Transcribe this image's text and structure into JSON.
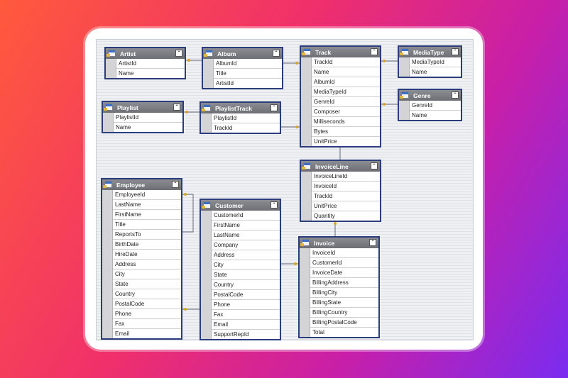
{
  "tables": {
    "artist": {
      "title": "Artist",
      "fields": [
        "ArtistId",
        "Name"
      ]
    },
    "album": {
      "title": "Album",
      "fields": [
        "AlbumId",
        "Title",
        "ArtistId"
      ]
    },
    "track": {
      "title": "Track",
      "fields": [
        "TrackId",
        "Name",
        "AlbumId",
        "MediaTypeId",
        "GenreId",
        "Composer",
        "Milliseconds",
        "Bytes",
        "UnitPrice"
      ]
    },
    "mediatype": {
      "title": "MediaType",
      "fields": [
        "MediaTypeId",
        "Name"
      ]
    },
    "genre": {
      "title": "Genre",
      "fields": [
        "GenreId",
        "Name"
      ]
    },
    "playlist": {
      "title": "Playlist",
      "fields": [
        "PlaylistId",
        "Name"
      ]
    },
    "playlisttrack": {
      "title": "PlaylistTrack",
      "fields": [
        "PlaylistId",
        "TrackId"
      ]
    },
    "invoiceline": {
      "title": "InvoiceLine",
      "fields": [
        "InvoiceLineId",
        "InvoiceId",
        "TrackId",
        "UnitPrice",
        "Quantity"
      ]
    },
    "employee": {
      "title": "Employee",
      "fields": [
        "EmployeeId",
        "LastName",
        "FirstName",
        "Title",
        "ReportsTo",
        "BirthDate",
        "HireDate",
        "Address",
        "City",
        "State",
        "Country",
        "PostalCode",
        "Phone",
        "Fax",
        "Email"
      ]
    },
    "customer": {
      "title": "Customer",
      "fields": [
        "CustomerId",
        "FirstName",
        "LastName",
        "Company",
        "Address",
        "City",
        "State",
        "Country",
        "PostalCode",
        "Phone",
        "Fax",
        "Email",
        "SupportRepId"
      ]
    },
    "invoice": {
      "title": "Invoice",
      "fields": [
        "InvoiceId",
        "CustomerId",
        "InvoiceDate",
        "BillingAddress",
        "BillingCity",
        "BillingState",
        "BillingCountry",
        "BillingPostalCode",
        "Total"
      ]
    }
  },
  "icons": {
    "table": "table-icon",
    "collapse": "collapse-icon",
    "primary_key": "key-icon"
  },
  "colors": {
    "table_border": "#2b3d7a",
    "header": "#7a7c82",
    "key": "#d9a521"
  }
}
